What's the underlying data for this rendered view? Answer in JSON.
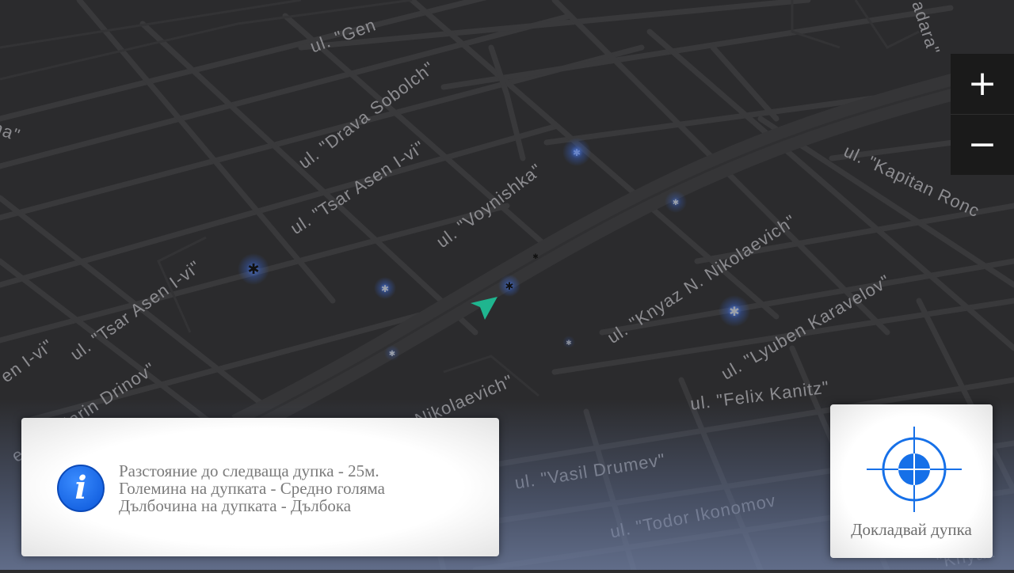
{
  "map": {
    "streets": [
      "ul. \"Gen",
      "adara\"",
      "ul. \"Drava Sobolch\"",
      "ul. \"Tsar Asen I-vi\"",
      "ul. \"Voynishka\"",
      "ul. \"Tsar Asen I-vi\"",
      "essor Marin Drinov\"",
      "en I-vi\"",
      "ul. \"Kapitan Ronc",
      "ul. \"Knyaz N. Nikolaevich\"",
      "ul. \"Lyuben Karavelov\"",
      "ul. \"Felix Kanitz\"",
      "ul. \"Vasil Drumev\"",
      "ul. \"Todor Ikonomov",
      "Nikolaevich\"",
      "ha\"",
      "\"Knyaz"
    ],
    "colors": {
      "background": "#2b2b2d",
      "road": "#3a3a3c",
      "main_road": "#333335",
      "label": "#8c8c90",
      "position_arrow": "#1fb58f",
      "pothole_glow": "#3f7fff"
    }
  },
  "zoom": {
    "in_label": "+",
    "out_label": "−"
  },
  "info": {
    "icon": "info-icon",
    "icon_glyph": "i",
    "lines": [
      "Разстояние до следваща дупка  - 25м.",
      "Големина на дупката - Средно голяма",
      "Дълбочина на дупката - Дълбока"
    ]
  },
  "report": {
    "icon": "crosshair-icon",
    "label": "Докладвай дупка",
    "accent": "#1670e8"
  }
}
